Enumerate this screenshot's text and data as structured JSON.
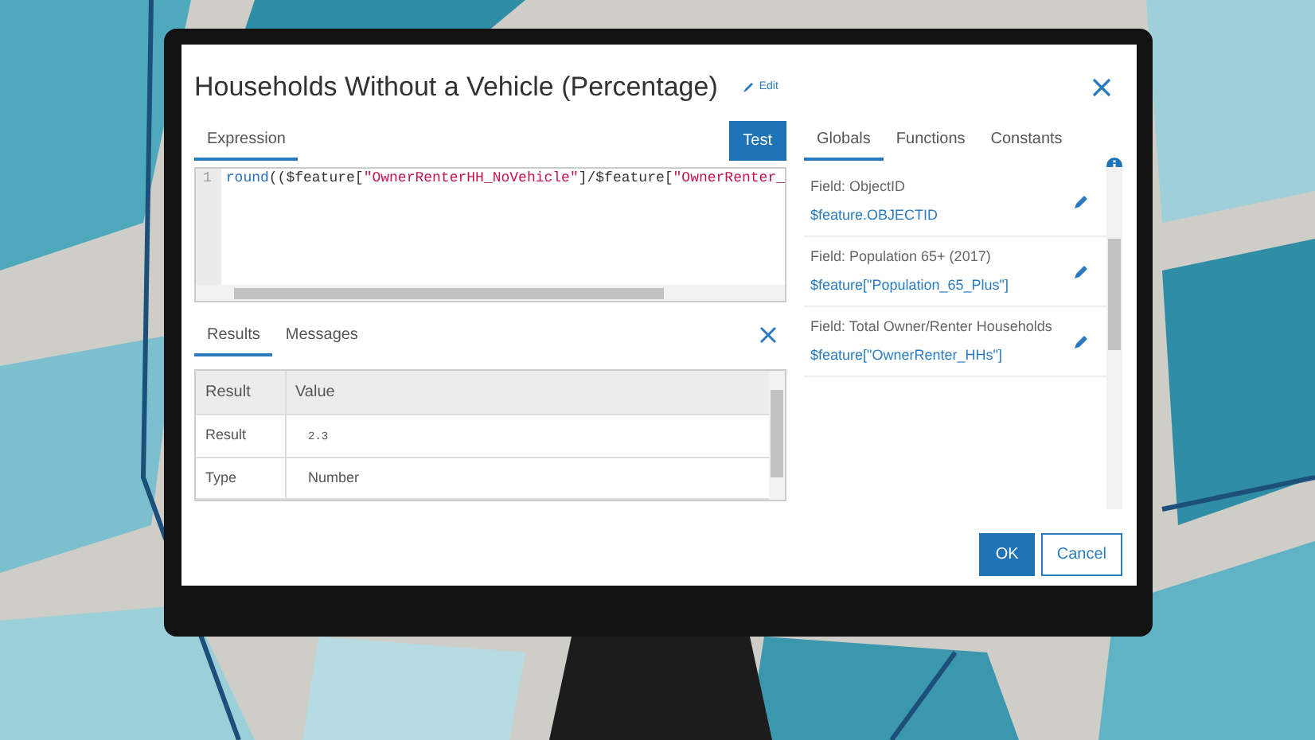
{
  "dialog": {
    "title": "Households Without a Vehicle (Percentage)",
    "edit_link": "Edit"
  },
  "expression_tab": {
    "label": "Expression",
    "selected": true
  },
  "test_button": "Test",
  "editor": {
    "lines": [
      {
        "number": "1",
        "tokens": [
          {
            "kind": "function",
            "text": "round"
          },
          {
            "kind": "plain",
            "text": "(($feature["
          },
          {
            "kind": "string",
            "text": "\"OwnerRenterHH_NoVehicle\""
          },
          {
            "kind": "plain",
            "text": "]/$feature["
          },
          {
            "kind": "string",
            "text": "\"OwnerRenter_"
          }
        ]
      }
    ]
  },
  "result_tabs": [
    {
      "label": "Results",
      "selected": true
    },
    {
      "label": "Messages",
      "selected": false
    }
  ],
  "results_table": {
    "columns": [
      "Result",
      "Value"
    ],
    "rows": [
      {
        "label": "Result",
        "value": "2.3",
        "kind": "code"
      },
      {
        "label": "Type",
        "value": "Number",
        "kind": "text"
      }
    ]
  },
  "side_tabs": [
    {
      "label": "Globals",
      "selected": true
    },
    {
      "label": "Functions",
      "selected": false
    },
    {
      "label": "Constants",
      "selected": false
    }
  ],
  "globals": [
    {
      "label": "Field: ObjectID",
      "expression": "$feature.OBJECTID"
    },
    {
      "label": "Field: Population 65+ (2017)",
      "expression": "$feature[\"Population_65_Plus\"]"
    },
    {
      "label": "Field: Total Owner/Renter Households",
      "expression": "$feature[\"OwnerRenter_HHs\"]"
    }
  ],
  "buttons": [
    {
      "label": "OK",
      "kind": "primary"
    },
    {
      "label": "Cancel",
      "kind": "secondary"
    }
  ]
}
